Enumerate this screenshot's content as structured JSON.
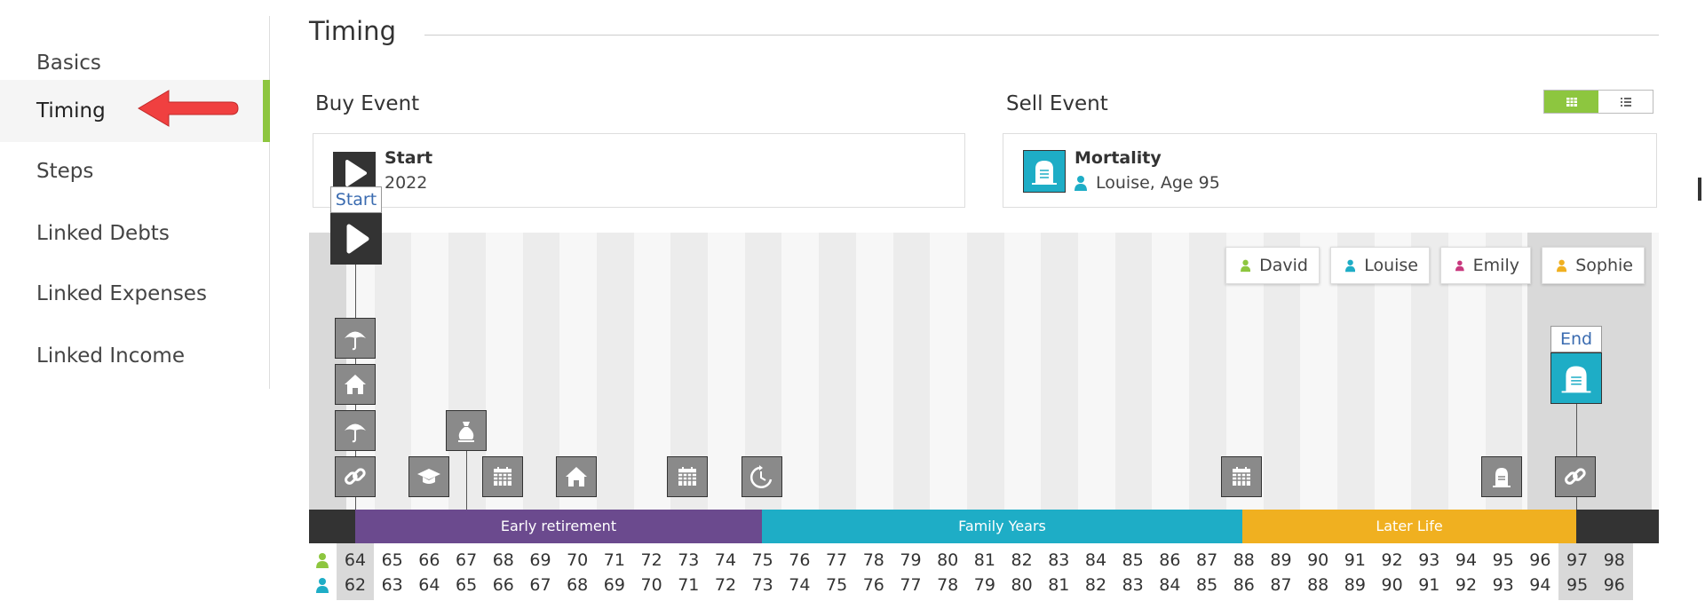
{
  "sidebar": {
    "items": [
      {
        "label": "Basics"
      },
      {
        "label": "Timing"
      },
      {
        "label": "Steps"
      },
      {
        "label": "Linked Debts"
      },
      {
        "label": "Linked Expenses"
      },
      {
        "label": "Linked Income"
      }
    ],
    "active_index": 1
  },
  "page_title": "Timing",
  "buy_event": {
    "section_label": "Buy Event",
    "name": "Start",
    "detail": "2022",
    "icon": "play-icon"
  },
  "sell_event": {
    "section_label": "Sell Event",
    "name": "Mortality",
    "detail": "Louise, Age 95",
    "icon": "tombstone-icon"
  },
  "timeline": {
    "start_label": "Start",
    "end_label": "End",
    "people": [
      {
        "name": "David",
        "color": "#8dc63f"
      },
      {
        "name": "Louise",
        "color": "#1eadc6"
      },
      {
        "name": "Emily",
        "color": "#c8387e"
      },
      {
        "name": "Sophie",
        "color": "#f0b020"
      }
    ],
    "phases": [
      {
        "label": "Early retirement",
        "color": "#6b4a8e"
      },
      {
        "label": "Family Years",
        "color": "#1eadc6"
      },
      {
        "label": "Later Life",
        "color": "#f0b020"
      }
    ],
    "ages_row1": [
      "64",
      "65",
      "66",
      "67",
      "68",
      "69",
      "70",
      "71",
      "72",
      "73",
      "74",
      "75",
      "76",
      "77",
      "78",
      "79",
      "80",
      "81",
      "82",
      "83",
      "84",
      "85",
      "86",
      "87",
      "88",
      "89",
      "90",
      "91",
      "92",
      "93",
      "94",
      "95",
      "96",
      "97",
      "98"
    ],
    "ages_row2": [
      "62",
      "63",
      "64",
      "65",
      "66",
      "67",
      "68",
      "69",
      "70",
      "71",
      "72",
      "73",
      "74",
      "75",
      "76",
      "77",
      "78",
      "79",
      "80",
      "81",
      "82",
      "83",
      "84",
      "85",
      "86",
      "87",
      "88",
      "89",
      "90",
      "91",
      "92",
      "93",
      "94",
      "95",
      "96"
    ],
    "events": [
      {
        "icon": "link-icon"
      },
      {
        "icon": "umbrella-icon"
      },
      {
        "icon": "house-icon"
      },
      {
        "icon": "umbrella-icon"
      },
      {
        "icon": "graduation-cap-icon"
      },
      {
        "icon": "money-bag-icon"
      },
      {
        "icon": "calendar-icon"
      },
      {
        "icon": "house-icon"
      },
      {
        "icon": "calendar-icon"
      },
      {
        "icon": "retirement-clock-icon"
      },
      {
        "icon": "calendar-icon"
      },
      {
        "icon": "tombstone-icon"
      },
      {
        "icon": "link-icon"
      }
    ]
  },
  "colors": {
    "accent_green": "#8dc63f",
    "teal": "#1eadc6",
    "purple": "#6b4a8e",
    "amber": "#f0b020",
    "dark": "#333333",
    "arrow_red": "#f04040"
  }
}
